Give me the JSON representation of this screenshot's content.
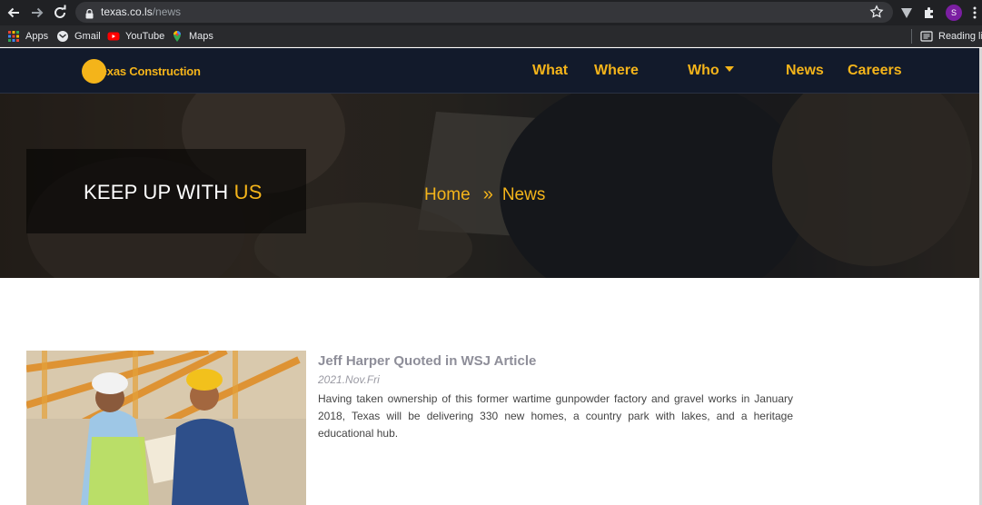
{
  "browser": {
    "url_host": "texas.co.ls",
    "url_path": "/news",
    "profile_initial": "S",
    "bookmarks": [
      {
        "label": "Apps",
        "icon": "apps-grid-icon"
      },
      {
        "label": "Gmail",
        "icon": "gmail-icon"
      },
      {
        "label": "YouTube",
        "icon": "youtube-icon"
      },
      {
        "label": "Maps",
        "icon": "maps-pin-icon"
      }
    ],
    "reading_list": "Reading list"
  },
  "site": {
    "logo_text": "Texas Construction",
    "nav": {
      "what": "What",
      "where": "Where",
      "who": "Who",
      "news": "News",
      "careers": "Careers"
    },
    "accent_color": "#f4b41a",
    "header_bg": "#121a2b"
  },
  "hero": {
    "title_main": "KEEP UP WITH",
    "title_accent": "US",
    "breadcrumb": {
      "home": "Home",
      "separator": "»",
      "current": "News"
    }
  },
  "article": {
    "title": "Jeff Harper Quoted in WSJ Article",
    "date": "2021.Nov.Fri",
    "body": "Having taken ownership of this former wartime gunpowder factory and gravel works in January 2018, Texas will be delivering 330 new homes, a country park with lakes, and a heritage educational hub."
  }
}
